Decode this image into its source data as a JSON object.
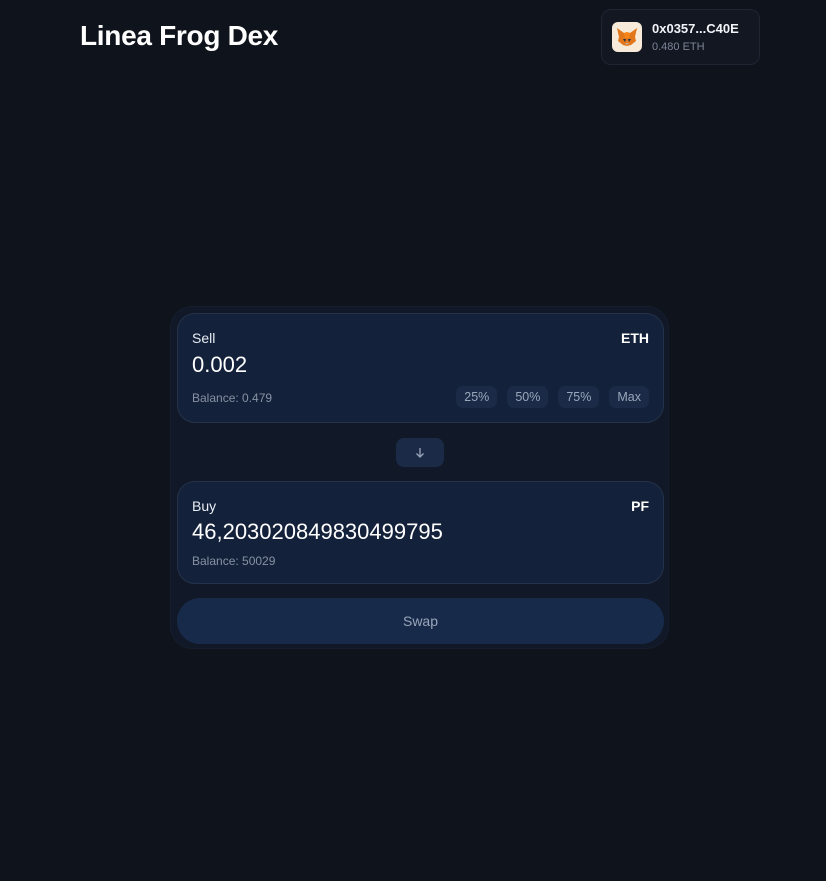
{
  "app": {
    "title": "Linea Frog Dex"
  },
  "wallet": {
    "address": "0x0357...C40E",
    "balance": "0.480 ETH",
    "icon": "metamask-fox-icon"
  },
  "swap": {
    "sell": {
      "label": "Sell",
      "token": "ETH",
      "amount": "0.002",
      "balance": "Balance: 0.479",
      "percent_buttons": [
        "25%",
        "50%",
        "75%",
        "Max"
      ]
    },
    "direction_icon": "arrow-down-icon",
    "buy": {
      "label": "Buy",
      "token": "PF",
      "amount": "46,203020849830499795",
      "balance": "Balance: 50029"
    },
    "button_label": "Swap"
  },
  "colors": {
    "background": "#0f131b",
    "card": "#111827",
    "panel": "#13213a",
    "button": "#172a4a",
    "muted_text": "#9aa6ba"
  }
}
